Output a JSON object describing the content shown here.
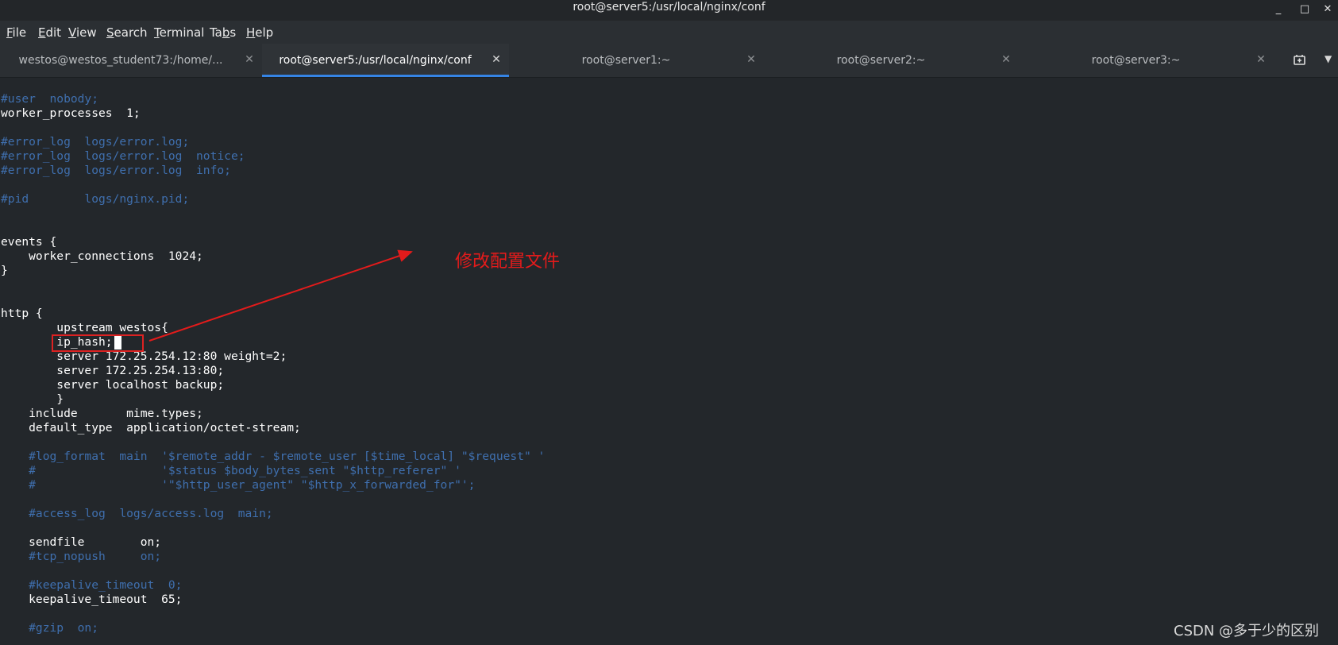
{
  "window": {
    "title": "root@server5:/usr/local/nginx/conf",
    "minimize_glyph": "_",
    "maximize_glyph": "□",
    "close_glyph": "✕"
  },
  "menu": [
    {
      "label": "File",
      "access_key": "F",
      "rest": "ile"
    },
    {
      "label": "Edit",
      "access_key": "E",
      "rest": "dit"
    },
    {
      "label": "View",
      "access_key": "V",
      "rest": "iew"
    },
    {
      "label": "Search",
      "access_key": "S",
      "rest": "earch"
    },
    {
      "label": "Terminal",
      "access_key": "T",
      "rest": "erminal"
    },
    {
      "label": "Tabs",
      "access_key": "b",
      "pre": "Ta",
      "rest": "s"
    },
    {
      "label": "Help",
      "access_key": "H",
      "rest": "elp"
    }
  ],
  "tabs": [
    {
      "label": "westos@westos_student73:/home/...",
      "active": false
    },
    {
      "label": "root@server5:/usr/local/nginx/conf",
      "active": true
    },
    {
      "label": "root@server1:~",
      "active": false
    },
    {
      "label": "root@server2:~",
      "active": false
    },
    {
      "label": "root@server3:~",
      "active": false
    }
  ],
  "tab_close_glyph": "✕",
  "tab_menu_glyph": "▼",
  "terminal_lines": [
    {
      "text": "#user  nobody;",
      "kind": "comment"
    },
    {
      "text": "worker_processes  1;",
      "kind": "normal"
    },
    {
      "text": "",
      "kind": "normal"
    },
    {
      "text": "#error_log  logs/error.log;",
      "kind": "comment"
    },
    {
      "text": "#error_log  logs/error.log  notice;",
      "kind": "comment"
    },
    {
      "text": "#error_log  logs/error.log  info;",
      "kind": "comment"
    },
    {
      "text": "",
      "kind": "normal"
    },
    {
      "text": "#pid        logs/nginx.pid;",
      "kind": "comment"
    },
    {
      "text": "",
      "kind": "normal"
    },
    {
      "text": "",
      "kind": "normal"
    },
    {
      "text": "events {",
      "kind": "normal"
    },
    {
      "text": "    worker_connections  1024;",
      "kind": "normal"
    },
    {
      "text": "}",
      "kind": "normal"
    },
    {
      "text": "",
      "kind": "normal"
    },
    {
      "text": "",
      "kind": "normal"
    },
    {
      "text": "http {",
      "kind": "normal"
    },
    {
      "text": "        upstream westos{",
      "kind": "normal"
    },
    {
      "text": "        ip_hash;",
      "kind": "normal"
    },
    {
      "text": "        server 172.25.254.12:80 weight=2;",
      "kind": "normal"
    },
    {
      "text": "        server 172.25.254.13:80;",
      "kind": "normal"
    },
    {
      "text": "        server localhost backup;",
      "kind": "normal"
    },
    {
      "text": "        }",
      "kind": "normal"
    },
    {
      "text": "    include       mime.types;",
      "kind": "normal"
    },
    {
      "text": "    default_type  application/octet-stream;",
      "kind": "normal"
    },
    {
      "text": "",
      "kind": "normal"
    },
    {
      "text": "    #log_format  main  '$remote_addr - $remote_user [$time_local] \"$request\" '",
      "kind": "comment"
    },
    {
      "text": "    #                  '$status $body_bytes_sent \"$http_referer\" '",
      "kind": "comment"
    },
    {
      "text": "    #                  '\"$http_user_agent\" \"$http_x_forwarded_for\"';",
      "kind": "comment"
    },
    {
      "text": "",
      "kind": "normal"
    },
    {
      "text": "    #access_log  logs/access.log  main;",
      "kind": "comment"
    },
    {
      "text": "",
      "kind": "normal"
    },
    {
      "text": "    sendfile        on;",
      "kind": "normal"
    },
    {
      "text": "    #tcp_nopush     on;",
      "kind": "comment"
    },
    {
      "text": "",
      "kind": "normal"
    },
    {
      "text": "    #keepalive_timeout  0;",
      "kind": "comment"
    },
    {
      "text": "    keepalive_timeout  65;",
      "kind": "normal"
    },
    {
      "text": "",
      "kind": "normal"
    },
    {
      "text": "    #gzip  on;",
      "kind": "comment"
    }
  ],
  "annotation": {
    "label": "修改配置文件",
    "color": "#e31b1b"
  },
  "watermark": "CSDN @多于少的区别",
  "colors": {
    "background": "#23272b",
    "comment": "#3f6fae",
    "text": "#ffffff",
    "tab_accent": "#3584e4"
  }
}
